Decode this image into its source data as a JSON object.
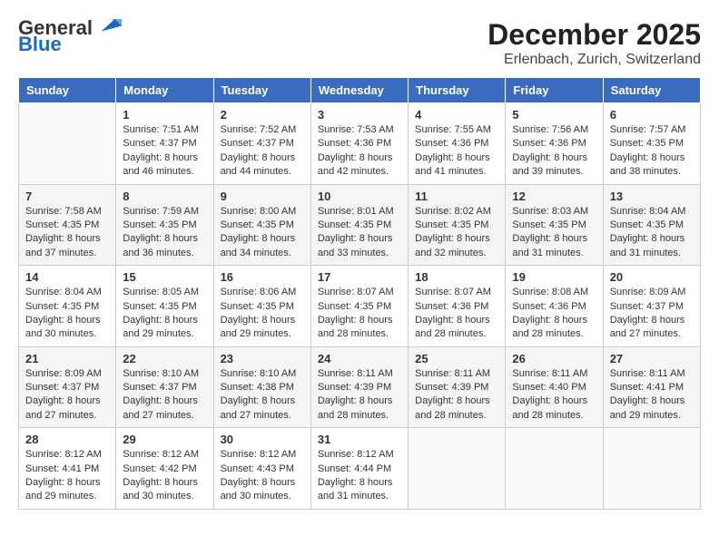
{
  "logo": {
    "line1": "General",
    "line2": "Blue"
  },
  "title": "December 2025",
  "subtitle": "Erlenbach, Zurich, Switzerland",
  "weekdays": [
    "Sunday",
    "Monday",
    "Tuesday",
    "Wednesday",
    "Thursday",
    "Friday",
    "Saturday"
  ],
  "weeks": [
    [
      {
        "day": "",
        "info": ""
      },
      {
        "day": "1",
        "info": "Sunrise: 7:51 AM\nSunset: 4:37 PM\nDaylight: 8 hours\nand 46 minutes."
      },
      {
        "day": "2",
        "info": "Sunrise: 7:52 AM\nSunset: 4:37 PM\nDaylight: 8 hours\nand 44 minutes."
      },
      {
        "day": "3",
        "info": "Sunrise: 7:53 AM\nSunset: 4:36 PM\nDaylight: 8 hours\nand 42 minutes."
      },
      {
        "day": "4",
        "info": "Sunrise: 7:55 AM\nSunset: 4:36 PM\nDaylight: 8 hours\nand 41 minutes."
      },
      {
        "day": "5",
        "info": "Sunrise: 7:56 AM\nSunset: 4:36 PM\nDaylight: 8 hours\nand 39 minutes."
      },
      {
        "day": "6",
        "info": "Sunrise: 7:57 AM\nSunset: 4:35 PM\nDaylight: 8 hours\nand 38 minutes."
      }
    ],
    [
      {
        "day": "7",
        "info": "Sunrise: 7:58 AM\nSunset: 4:35 PM\nDaylight: 8 hours\nand 37 minutes."
      },
      {
        "day": "8",
        "info": "Sunrise: 7:59 AM\nSunset: 4:35 PM\nDaylight: 8 hours\nand 36 minutes."
      },
      {
        "day": "9",
        "info": "Sunrise: 8:00 AM\nSunset: 4:35 PM\nDaylight: 8 hours\nand 34 minutes."
      },
      {
        "day": "10",
        "info": "Sunrise: 8:01 AM\nSunset: 4:35 PM\nDaylight: 8 hours\nand 33 minutes."
      },
      {
        "day": "11",
        "info": "Sunrise: 8:02 AM\nSunset: 4:35 PM\nDaylight: 8 hours\nand 32 minutes."
      },
      {
        "day": "12",
        "info": "Sunrise: 8:03 AM\nSunset: 4:35 PM\nDaylight: 8 hours\nand 31 minutes."
      },
      {
        "day": "13",
        "info": "Sunrise: 8:04 AM\nSunset: 4:35 PM\nDaylight: 8 hours\nand 31 minutes."
      }
    ],
    [
      {
        "day": "14",
        "info": "Sunrise: 8:04 AM\nSunset: 4:35 PM\nDaylight: 8 hours\nand 30 minutes."
      },
      {
        "day": "15",
        "info": "Sunrise: 8:05 AM\nSunset: 4:35 PM\nDaylight: 8 hours\nand 29 minutes."
      },
      {
        "day": "16",
        "info": "Sunrise: 8:06 AM\nSunset: 4:35 PM\nDaylight: 8 hours\nand 29 minutes."
      },
      {
        "day": "17",
        "info": "Sunrise: 8:07 AM\nSunset: 4:35 PM\nDaylight: 8 hours\nand 28 minutes."
      },
      {
        "day": "18",
        "info": "Sunrise: 8:07 AM\nSunset: 4:36 PM\nDaylight: 8 hours\nand 28 minutes."
      },
      {
        "day": "19",
        "info": "Sunrise: 8:08 AM\nSunset: 4:36 PM\nDaylight: 8 hours\nand 28 minutes."
      },
      {
        "day": "20",
        "info": "Sunrise: 8:09 AM\nSunset: 4:37 PM\nDaylight: 8 hours\nand 27 minutes."
      }
    ],
    [
      {
        "day": "21",
        "info": "Sunrise: 8:09 AM\nSunset: 4:37 PM\nDaylight: 8 hours\nand 27 minutes."
      },
      {
        "day": "22",
        "info": "Sunrise: 8:10 AM\nSunset: 4:37 PM\nDaylight: 8 hours\nand 27 minutes."
      },
      {
        "day": "23",
        "info": "Sunrise: 8:10 AM\nSunset: 4:38 PM\nDaylight: 8 hours\nand 27 minutes."
      },
      {
        "day": "24",
        "info": "Sunrise: 8:11 AM\nSunset: 4:39 PM\nDaylight: 8 hours\nand 28 minutes."
      },
      {
        "day": "25",
        "info": "Sunrise: 8:11 AM\nSunset: 4:39 PM\nDaylight: 8 hours\nand 28 minutes."
      },
      {
        "day": "26",
        "info": "Sunrise: 8:11 AM\nSunset: 4:40 PM\nDaylight: 8 hours\nand 28 minutes."
      },
      {
        "day": "27",
        "info": "Sunrise: 8:11 AM\nSunset: 4:41 PM\nDaylight: 8 hours\nand 29 minutes."
      }
    ],
    [
      {
        "day": "28",
        "info": "Sunrise: 8:12 AM\nSunset: 4:41 PM\nDaylight: 8 hours\nand 29 minutes."
      },
      {
        "day": "29",
        "info": "Sunrise: 8:12 AM\nSunset: 4:42 PM\nDaylight: 8 hours\nand 30 minutes."
      },
      {
        "day": "30",
        "info": "Sunrise: 8:12 AM\nSunset: 4:43 PM\nDaylight: 8 hours\nand 30 minutes."
      },
      {
        "day": "31",
        "info": "Sunrise: 8:12 AM\nSunset: 4:44 PM\nDaylight: 8 hours\nand 31 minutes."
      },
      {
        "day": "",
        "info": ""
      },
      {
        "day": "",
        "info": ""
      },
      {
        "day": "",
        "info": ""
      }
    ]
  ]
}
